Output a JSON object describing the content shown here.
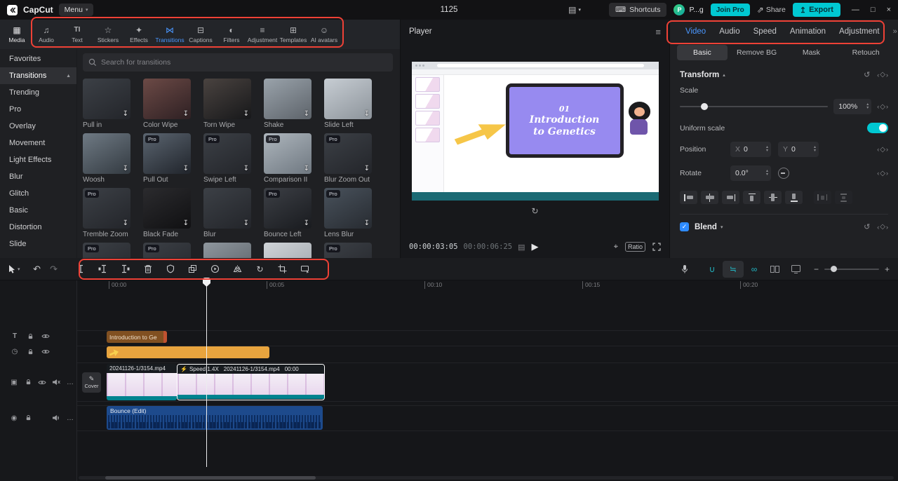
{
  "colors": {
    "accent_blue": "#4a97ff",
    "accent_cyan": "#00c8d2",
    "annotation_red": "#ee4136",
    "clip_teal": "#00838f",
    "audio_clip_blue": "#1d4a8c",
    "sticker_clip_orange": "#e8a43e",
    "text_clip_brown": "#815021"
  },
  "titlebar": {
    "app_name": "CapCut",
    "menu_label": "Menu",
    "doc_title": "1125",
    "shortcuts_label": "Shortcuts",
    "avatar_letter": "P",
    "account_label": "P...g",
    "join_pro_label": "Join Pro",
    "share_label": "Share",
    "export_label": "Export"
  },
  "left_toolbar": {
    "items": [
      {
        "icon": "▦",
        "label": "Media"
      },
      {
        "icon": "♫",
        "label": "Audio"
      },
      {
        "icon": "TI",
        "label": "Text"
      },
      {
        "icon": "☆",
        "label": "Stickers"
      },
      {
        "icon": "✦",
        "label": "Effects"
      },
      {
        "icon": "⋈",
        "label": "Transitions"
      },
      {
        "icon": "⊟",
        "label": "Captions"
      },
      {
        "icon": "◐",
        "label": "Filters"
      },
      {
        "icon": "≡",
        "label": "Adjustment"
      },
      {
        "icon": "⊞",
        "label": "Templates"
      },
      {
        "icon": "☺",
        "label": "AI avatars"
      }
    ]
  },
  "sidebar": {
    "items": [
      "Favorites",
      "Transitions",
      "Trending",
      "Pro",
      "Overlay",
      "Movement",
      "Light Effects",
      "Blur",
      "Glitch",
      "Basic",
      "Distortion",
      "Slide"
    ]
  },
  "search": {
    "placeholder": "Search for transitions"
  },
  "badges": {
    "pro": "Pro"
  },
  "transitions": {
    "items": [
      {
        "label": "Pull in",
        "pro": false
      },
      {
        "label": "Color Wipe",
        "pro": false
      },
      {
        "label": "Torn Wipe",
        "pro": false
      },
      {
        "label": "Shake",
        "pro": false
      },
      {
        "label": "Slide Left",
        "pro": false
      },
      {
        "label": "Woosh",
        "pro": false
      },
      {
        "label": "Pull Out",
        "pro": true
      },
      {
        "label": "Swipe Left",
        "pro": true
      },
      {
        "label": "Comparison II",
        "pro": true
      },
      {
        "label": "Blur Zoom Out",
        "pro": true
      },
      {
        "label": "Tremble Zoom",
        "pro": true
      },
      {
        "label": "Black Fade",
        "pro": false
      },
      {
        "label": "Blur",
        "pro": false
      },
      {
        "label": "Bounce Left",
        "pro": true
      },
      {
        "label": "Lens Blur",
        "pro": true
      },
      {
        "label": "",
        "pro": true
      },
      {
        "label": "",
        "pro": true
      },
      {
        "label": "",
        "pro": false
      },
      {
        "label": "",
        "pro": false
      },
      {
        "label": "",
        "pro": true
      }
    ]
  },
  "player": {
    "title": "Player",
    "current_time": "00:00:03:05",
    "total_time": "00:00:06:25",
    "ratio_label": "Ratio"
  },
  "preview": {
    "slide_number": "01",
    "slide_title_line1": "Introduction",
    "slide_title_line2": "to Genetics"
  },
  "right_panel": {
    "tabs": [
      "Video",
      "Audio",
      "Speed",
      "Animation",
      "Adjustment"
    ],
    "subtabs": [
      "Basic",
      "Remove BG",
      "Mask",
      "Retouch"
    ],
    "transform": {
      "title": "Transform",
      "scale_label": "Scale",
      "scale_value": "100%",
      "uniform_scale_label": "Uniform scale",
      "position_label": "Position",
      "x_label": "X",
      "x_value": "0",
      "y_label": "Y",
      "y_value": "0",
      "rotate_label": "Rotate",
      "rotate_value": "0.0°"
    },
    "blend_label": "Blend"
  },
  "timeline": {
    "ruler": [
      "00:00",
      "00:05",
      "00:10",
      "00:15",
      "00:20"
    ],
    "cover_label": "Cover",
    "text_clip_label": "Introduction to Ge",
    "video_clip1_label": "20241126-1/3154.mp4",
    "speed_badge": "Speed 1.4X",
    "video_clip2_label": "20241126-1/3154.mp4",
    "clip2_time": "00:00",
    "audio_clip_label": "Bounce (Edit)"
  },
  "icons": {
    "menu_caret": "▾",
    "layout": "▤",
    "layout_caret": "▾",
    "keyboard": "⌨",
    "share": "⇗",
    "export_arrow": "↥",
    "minimize": "—",
    "maximize": "□",
    "close": "×",
    "pin": "▲",
    "download": "↧",
    "hamburger": "≡",
    "replay": "↻",
    "play": "▶",
    "screenshot": "⌖",
    "grid_view": "▤",
    "expand_double": "»",
    "reset": "↺",
    "kf_left": "‹",
    "kf_diamond": "◇",
    "kf_right": "›",
    "caret_up": "▴",
    "caret_down": "▾",
    "undo": "↶",
    "redo": "↷",
    "rotate_cw": "↻",
    "more": "…",
    "lightning": "⚡",
    "pencil": "✎",
    "type_text": "T",
    "type_sticker": "◷",
    "type_video": "▣",
    "type_audio": "◉",
    "zoom_out": "−",
    "zoom_in": "+",
    "checkmark": "✓",
    "magnet": "∪",
    "ripple": "≒",
    "link": "∞"
  }
}
